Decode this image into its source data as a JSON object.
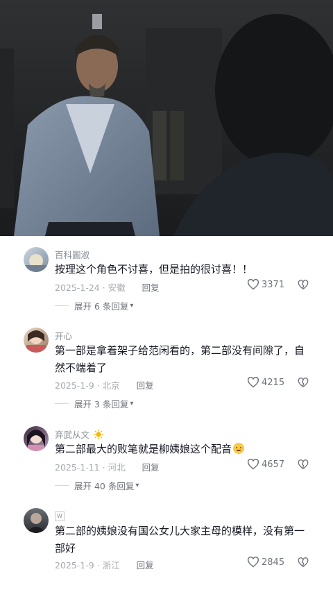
{
  "video": {
    "description_icon": "video-frame"
  },
  "comments": [
    {
      "username": "百科圖淑",
      "text": "按理这个角色不讨喜，但是拍的很讨喜！！",
      "date_location": "2025-1-24 · 安徽",
      "reply_label": "回复",
      "likes": "3371",
      "expand_label": "展开 6 条回复",
      "badge": ""
    },
    {
      "username": "开心",
      "text": "第一部是拿着架子给范闲看的，第二部没有间隙了，自然不端着了",
      "date_location": "2025-1-9 · 北京",
      "reply_label": "回复",
      "likes": "4215",
      "expand_label": "展开 3 条回复",
      "badge": ""
    },
    {
      "username": "弃武从文",
      "text": "第二部最大的败笔就是柳姨娘这个配音",
      "date_location": "2025-1-11 · 河北",
      "reply_label": "回复",
      "likes": "4657",
      "expand_label": "展开 40 条回复",
      "badge": "sun-emoji"
    },
    {
      "username": "W",
      "text": "第二部的姨娘没有国公女儿大家主母的模样，没有第一部好",
      "date_location": "2025-1-9 · 浙江",
      "reply_label": "回复",
      "likes": "2845",
      "expand_label": "",
      "badge": ""
    }
  ],
  "icons": {
    "like": "heart-outline-icon",
    "dislike": "broken-heart-icon",
    "expand": "chevron-down-icon"
  }
}
